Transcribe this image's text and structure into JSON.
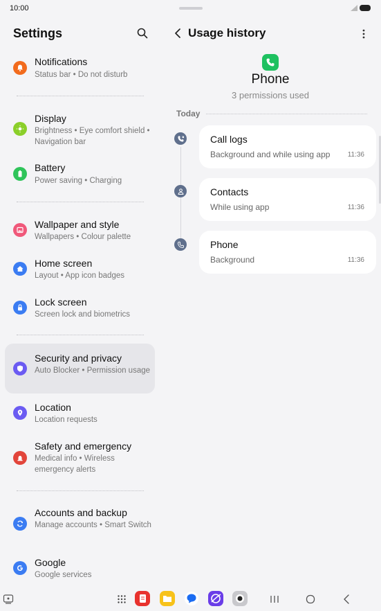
{
  "status_bar": {
    "time": "10:00"
  },
  "settings": {
    "title": "Settings",
    "items": [
      {
        "title": "Notifications",
        "sub": "Status bar  •  Do not disturb",
        "icon": "notifications-icon",
        "color": "#f26b1d"
      },
      {
        "title": "Display",
        "sub": "Brightness  •  Eye comfort shield  •  Navigation bar",
        "icon": "display-icon",
        "color": "#8bcf2a"
      },
      {
        "title": "Battery",
        "sub": "Power saving  •  Charging",
        "icon": "battery-settings-icon",
        "color": "#2fc45a"
      },
      {
        "title": "Wallpaper and style",
        "sub": "Wallpapers  •  Colour palette",
        "icon": "wallpaper-icon",
        "color": "#f0587a"
      },
      {
        "title": "Home screen",
        "sub": "Layout  •  App icon badges",
        "icon": "home-icon",
        "color": "#3b7cf2"
      },
      {
        "title": "Lock screen",
        "sub": "Screen lock and biometrics",
        "icon": "lock-icon",
        "color": "#3b7cf2"
      },
      {
        "title": "Security and privacy",
        "sub": "Auto Blocker  •  Permission usage",
        "icon": "shield-icon",
        "color": "#6b5bf2"
      },
      {
        "title": "Location",
        "sub": "Location requests",
        "icon": "location-icon",
        "color": "#6b5bf2"
      },
      {
        "title": "Safety and emergency",
        "sub": "Medical info  •  Wireless emergency alerts",
        "icon": "emergency-icon",
        "color": "#e2453b"
      },
      {
        "title": "Accounts and backup",
        "sub": "Manage accounts  •  Smart Switch",
        "icon": "sync-icon",
        "color": "#3b7cf2"
      },
      {
        "title": "Google",
        "sub": "Google services",
        "icon": "google-icon",
        "color": "#3b7cf2"
      }
    ]
  },
  "usage": {
    "title": "Usage history",
    "app_name": "Phone",
    "permissions_used": "3 permissions used",
    "day_label": "Today",
    "entries": [
      {
        "title": "Call logs",
        "sub": "Background and while using app",
        "time": "11:36",
        "icon": "call-log-icon"
      },
      {
        "title": "Contacts",
        "sub": "While using app",
        "time": "11:36",
        "icon": "contacts-icon"
      },
      {
        "title": "Phone",
        "sub": "Background",
        "time": "11:36",
        "icon": "phone-icon"
      }
    ]
  },
  "nav": {
    "dock_apps": [
      "notes-app-icon",
      "my-files-app-icon",
      "messages-app-icon",
      "internet-app-icon",
      "camera-app-icon"
    ]
  }
}
